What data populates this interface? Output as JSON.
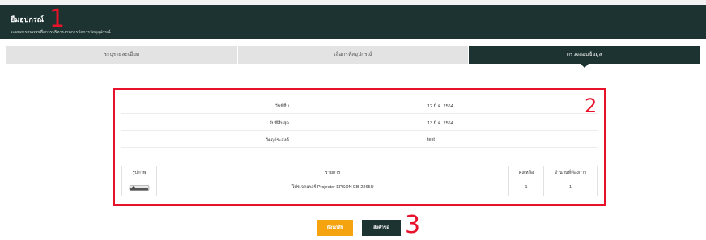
{
  "header": {
    "title": "ยืมอุปกรณ์",
    "subtitle": "ระบบสารสนเทศเพื่อการบริหารงานการจัดการวัสดุอุปกรณ์"
  },
  "annotations": {
    "step1": "1",
    "step2": "2",
    "step3": "3"
  },
  "tabs": [
    {
      "label": "ระบุรายละเอียด",
      "active": false
    },
    {
      "label": "เลือกรหัสอุปกรณ์",
      "active": false
    },
    {
      "label": "ตรวจสอบข้อมูล",
      "active": true
    }
  ],
  "summary": {
    "rows": [
      {
        "label": "วันที่ยืม",
        "value": "12 มี.ค. 2564"
      },
      {
        "label": "วันที่สิ้นสุด",
        "value": "13 มี.ค. 2564"
      },
      {
        "label": "วัตถุประสงค์",
        "value": "test"
      }
    ]
  },
  "items_table": {
    "headers": {
      "image": "รูปภาพ",
      "item": "รายการ",
      "remaining": "คงเหลือ",
      "quantity": "จำนวนที่ต้องการ"
    },
    "rows": [
      {
        "image_icon": "projector-icon",
        "item": "โปรเจคเตอร์ Projector EPSON EB-2265U",
        "remaining": "1",
        "quantity": "1"
      }
    ]
  },
  "buttons": {
    "back": "ย้อนกลับ",
    "submit": "ส่งคำขอ"
  },
  "colors": {
    "primary": "#1c3331",
    "accent": "#f5a30f",
    "annotation": "#e8132b"
  }
}
